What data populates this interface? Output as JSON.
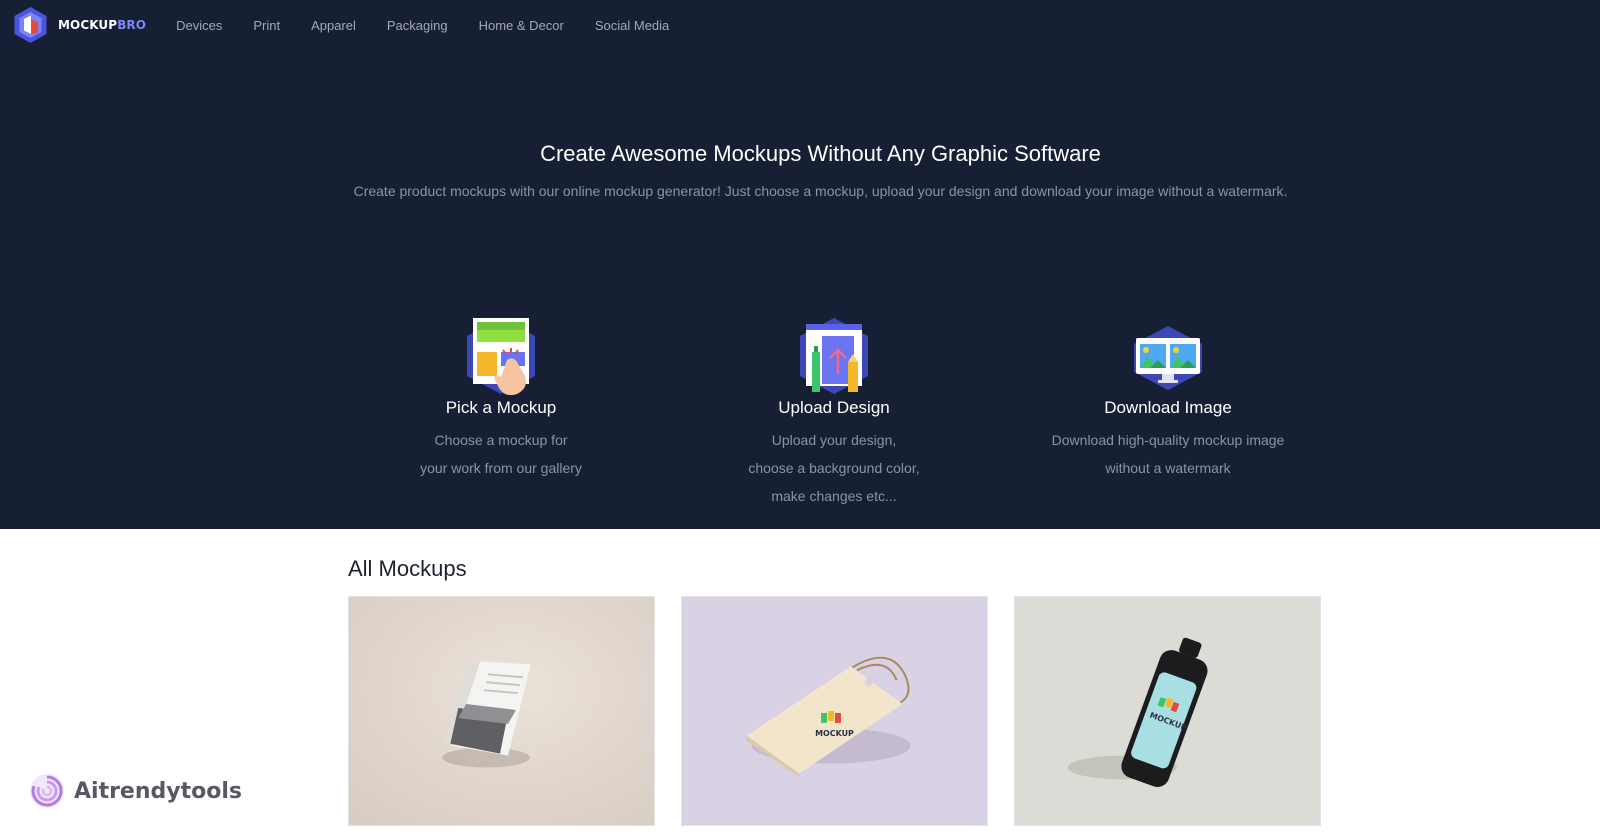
{
  "brand": {
    "name_main": "MOCKUP",
    "name_accent": "BRO",
    "accent_color": "#7f86f7",
    "logo_icon": "hexagon-cube-icon"
  },
  "nav": {
    "items": [
      {
        "label": "Devices"
      },
      {
        "label": "Print"
      },
      {
        "label": "Apparel"
      },
      {
        "label": "Packaging"
      },
      {
        "label": "Home & Decor"
      },
      {
        "label": "Social Media"
      }
    ]
  },
  "hero": {
    "title": "Create Awesome Mockups Without Any Graphic Software",
    "subtitle": "Create product mockups with our online mockup generator! Just choose a mockup, upload your design and download your image without a watermark."
  },
  "steps": [
    {
      "icon": "pick-mockup-icon",
      "title": "Pick a Mockup",
      "desc": [
        "Choose a mockup for",
        "your work from our gallery"
      ]
    },
    {
      "icon": "upload-design-icon",
      "title": "Upload Design",
      "desc": [
        "Upload your design,",
        "choose a background color,",
        "make changes etc..."
      ]
    },
    {
      "icon": "download-image-icon",
      "title": "Download Image",
      "desc": [
        "Download high-quality mockup image",
        "without a watermark"
      ]
    }
  ],
  "section": {
    "title": "All Mockups"
  },
  "cards": [
    {
      "name": "brochure-mockup",
      "bg": "#e4dad2"
    },
    {
      "name": "tag-mockup",
      "bg": "#d9d1e4",
      "label": "MOCKUP"
    },
    {
      "name": "bottle-mockup",
      "bg": "#dcdcd6",
      "label": "MOCKUP"
    }
  ],
  "watermark": {
    "text": "Aitrendytools",
    "icon": "swirl-icon"
  },
  "colors": {
    "dark_bg": "#171f35",
    "muted_text": "#8d93a6",
    "nav_text": "#a3a8b8"
  }
}
